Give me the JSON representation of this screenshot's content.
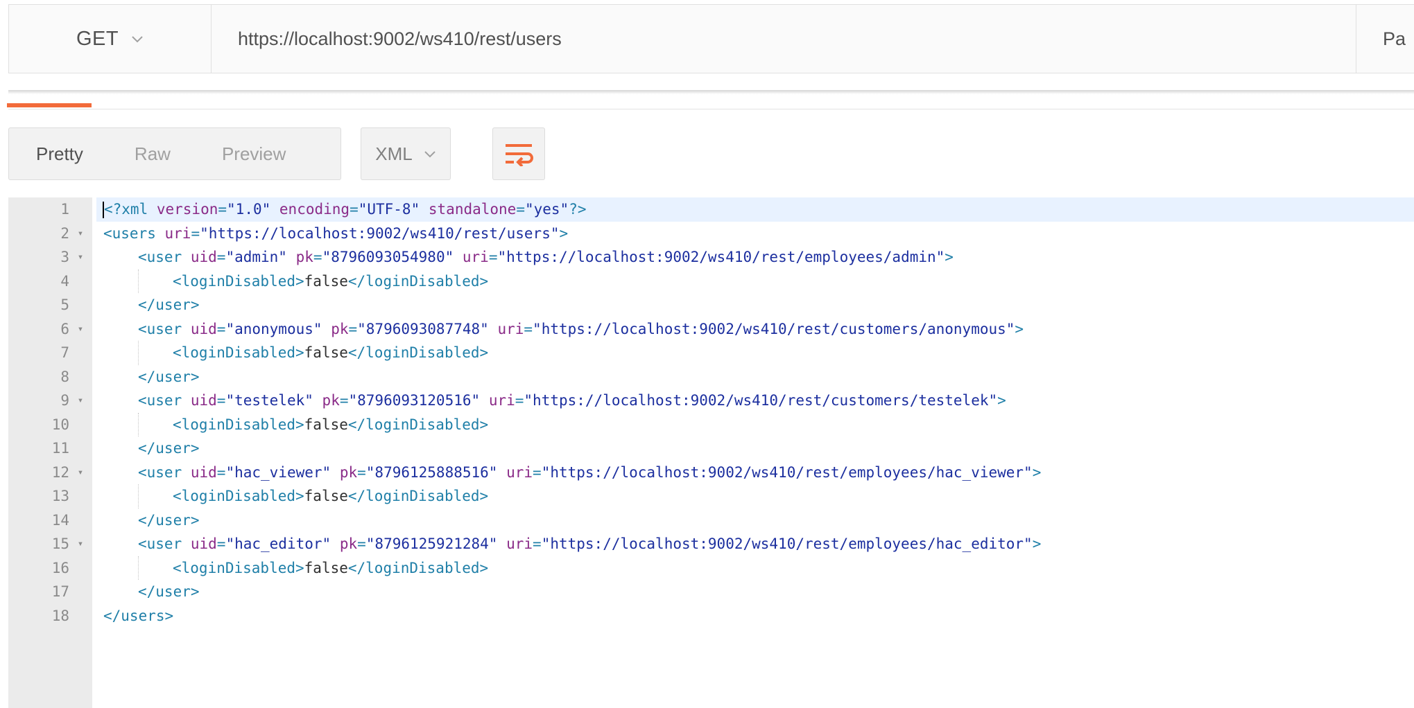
{
  "request": {
    "method": "GET",
    "url": "https://localhost:9002/ws410/rest/users",
    "params_label": "Pa"
  },
  "response_toolbar": {
    "view_tabs": [
      "Pretty",
      "Raw",
      "Preview"
    ],
    "active_view": "Pretty",
    "format": "XML",
    "wrap_icon": "wrap-lines-icon"
  },
  "colors": {
    "accent": "#f26b3a",
    "tag": "#1f7fa8",
    "attribute": "#8a2b88",
    "value": "#1c2f9f"
  },
  "editor": {
    "lines": [
      {
        "n": "1",
        "fold": false,
        "indent": 0,
        "tokens": [
          [
            "tag",
            "<?xml "
          ],
          [
            "attr",
            "version"
          ],
          [
            "tag",
            "="
          ],
          [
            "val",
            "\"1.0\""
          ],
          [
            "tag",
            " "
          ],
          [
            "attr",
            "encoding"
          ],
          [
            "tag",
            "="
          ],
          [
            "val",
            "\"UTF-8\""
          ],
          [
            "tag",
            " "
          ],
          [
            "attr",
            "standalone"
          ],
          [
            "tag",
            "="
          ],
          [
            "val",
            "\"yes\""
          ],
          [
            "tag",
            "?>"
          ]
        ]
      },
      {
        "n": "2",
        "fold": true,
        "indent": 0,
        "tokens": [
          [
            "tag",
            "<users "
          ],
          [
            "attr",
            "uri"
          ],
          [
            "tag",
            "="
          ],
          [
            "val",
            "\"https://localhost:9002/ws410/rest/users\""
          ],
          [
            "tag",
            ">"
          ]
        ]
      },
      {
        "n": "3",
        "fold": true,
        "indent": 1,
        "tokens": [
          [
            "tag",
            "<user "
          ],
          [
            "attr",
            "uid"
          ],
          [
            "tag",
            "="
          ],
          [
            "val",
            "\"admin\""
          ],
          [
            "tag",
            " "
          ],
          [
            "attr",
            "pk"
          ],
          [
            "tag",
            "="
          ],
          [
            "val",
            "\"8796093054980\""
          ],
          [
            "tag",
            " "
          ],
          [
            "attr",
            "uri"
          ],
          [
            "tag",
            "="
          ],
          [
            "val",
            "\"https://localhost:9002/ws410/rest/employees/admin\""
          ],
          [
            "tag",
            ">"
          ]
        ]
      },
      {
        "n": "4",
        "fold": false,
        "indent": 2,
        "tokens": [
          [
            "tag",
            "<loginDisabled>"
          ],
          [
            "text",
            "false"
          ],
          [
            "tag",
            "</loginDisabled>"
          ]
        ]
      },
      {
        "n": "5",
        "fold": false,
        "indent": 1,
        "tokens": [
          [
            "tag",
            "</user>"
          ]
        ]
      },
      {
        "n": "6",
        "fold": true,
        "indent": 1,
        "tokens": [
          [
            "tag",
            "<user "
          ],
          [
            "attr",
            "uid"
          ],
          [
            "tag",
            "="
          ],
          [
            "val",
            "\"anonymous\""
          ],
          [
            "tag",
            " "
          ],
          [
            "attr",
            "pk"
          ],
          [
            "tag",
            "="
          ],
          [
            "val",
            "\"8796093087748\""
          ],
          [
            "tag",
            " "
          ],
          [
            "attr",
            "uri"
          ],
          [
            "tag",
            "="
          ],
          [
            "val",
            "\"https://localhost:9002/ws410/rest/customers/anonymous\""
          ],
          [
            "tag",
            ">"
          ]
        ]
      },
      {
        "n": "7",
        "fold": false,
        "indent": 2,
        "tokens": [
          [
            "tag",
            "<loginDisabled>"
          ],
          [
            "text",
            "false"
          ],
          [
            "tag",
            "</loginDisabled>"
          ]
        ]
      },
      {
        "n": "8",
        "fold": false,
        "indent": 1,
        "tokens": [
          [
            "tag",
            "</user>"
          ]
        ]
      },
      {
        "n": "9",
        "fold": true,
        "indent": 1,
        "tokens": [
          [
            "tag",
            "<user "
          ],
          [
            "attr",
            "uid"
          ],
          [
            "tag",
            "="
          ],
          [
            "val",
            "\"testelek\""
          ],
          [
            "tag",
            " "
          ],
          [
            "attr",
            "pk"
          ],
          [
            "tag",
            "="
          ],
          [
            "val",
            "\"8796093120516\""
          ],
          [
            "tag",
            " "
          ],
          [
            "attr",
            "uri"
          ],
          [
            "tag",
            "="
          ],
          [
            "val",
            "\"https://localhost:9002/ws410/rest/customers/testelek\""
          ],
          [
            "tag",
            ">"
          ]
        ]
      },
      {
        "n": "10",
        "fold": false,
        "indent": 2,
        "tokens": [
          [
            "tag",
            "<loginDisabled>"
          ],
          [
            "text",
            "false"
          ],
          [
            "tag",
            "</loginDisabled>"
          ]
        ]
      },
      {
        "n": "11",
        "fold": false,
        "indent": 1,
        "tokens": [
          [
            "tag",
            "</user>"
          ]
        ]
      },
      {
        "n": "12",
        "fold": true,
        "indent": 1,
        "tokens": [
          [
            "tag",
            "<user "
          ],
          [
            "attr",
            "uid"
          ],
          [
            "tag",
            "="
          ],
          [
            "val",
            "\"hac_viewer\""
          ],
          [
            "tag",
            " "
          ],
          [
            "attr",
            "pk"
          ],
          [
            "tag",
            "="
          ],
          [
            "val",
            "\"8796125888516\""
          ],
          [
            "tag",
            " "
          ],
          [
            "attr",
            "uri"
          ],
          [
            "tag",
            "="
          ],
          [
            "val",
            "\"https://localhost:9002/ws410/rest/employees/hac_viewer\""
          ],
          [
            "tag",
            ">"
          ]
        ]
      },
      {
        "n": "13",
        "fold": false,
        "indent": 2,
        "tokens": [
          [
            "tag",
            "<loginDisabled>"
          ],
          [
            "text",
            "false"
          ],
          [
            "tag",
            "</loginDisabled>"
          ]
        ]
      },
      {
        "n": "14",
        "fold": false,
        "indent": 1,
        "tokens": [
          [
            "tag",
            "</user>"
          ]
        ]
      },
      {
        "n": "15",
        "fold": true,
        "indent": 1,
        "tokens": [
          [
            "tag",
            "<user "
          ],
          [
            "attr",
            "uid"
          ],
          [
            "tag",
            "="
          ],
          [
            "val",
            "\"hac_editor\""
          ],
          [
            "tag",
            " "
          ],
          [
            "attr",
            "pk"
          ],
          [
            "tag",
            "="
          ],
          [
            "val",
            "\"8796125921284\""
          ],
          [
            "tag",
            " "
          ],
          [
            "attr",
            "uri"
          ],
          [
            "tag",
            "="
          ],
          [
            "val",
            "\"https://localhost:9002/ws410/rest/employees/hac_editor\""
          ],
          [
            "tag",
            ">"
          ]
        ]
      },
      {
        "n": "16",
        "fold": false,
        "indent": 2,
        "tokens": [
          [
            "tag",
            "<loginDisabled>"
          ],
          [
            "text",
            "false"
          ],
          [
            "tag",
            "</loginDisabled>"
          ]
        ]
      },
      {
        "n": "17",
        "fold": false,
        "indent": 1,
        "tokens": [
          [
            "tag",
            "</user>"
          ]
        ]
      },
      {
        "n": "18",
        "fold": false,
        "indent": 0,
        "tokens": [
          [
            "tag",
            "</users>"
          ]
        ]
      }
    ]
  }
}
